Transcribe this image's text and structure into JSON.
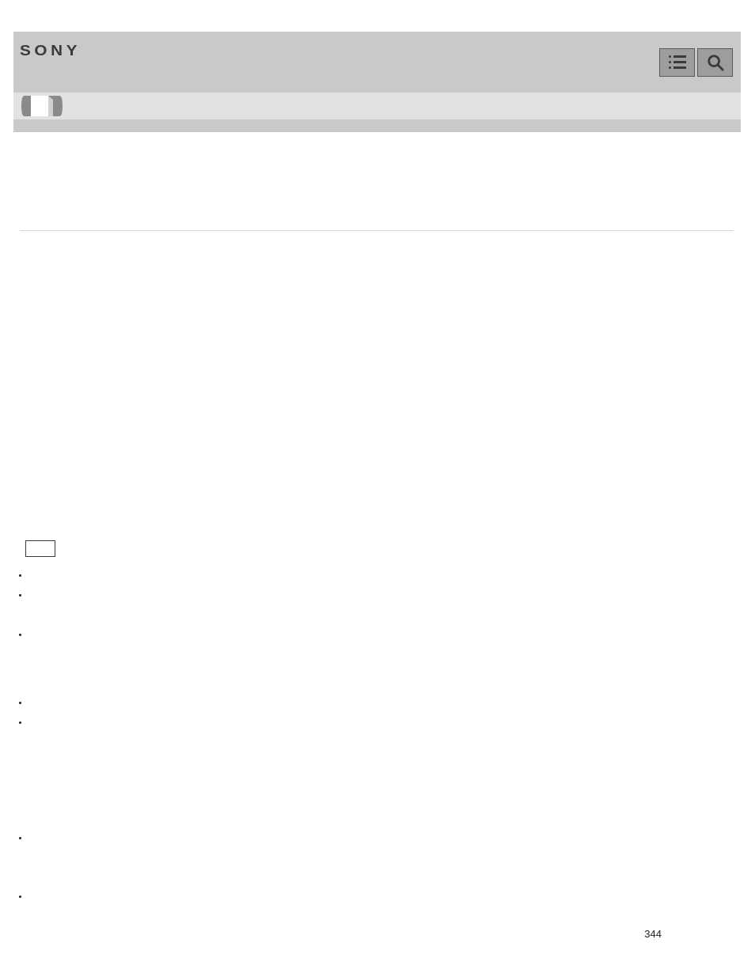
{
  "brand": "SONY",
  "pageNumber": "344",
  "bulletGroups": {
    "g1": [
      "",
      "",
      ""
    ],
    "g2": [
      "",
      ""
    ],
    "g3": [
      "",
      ""
    ]
  }
}
